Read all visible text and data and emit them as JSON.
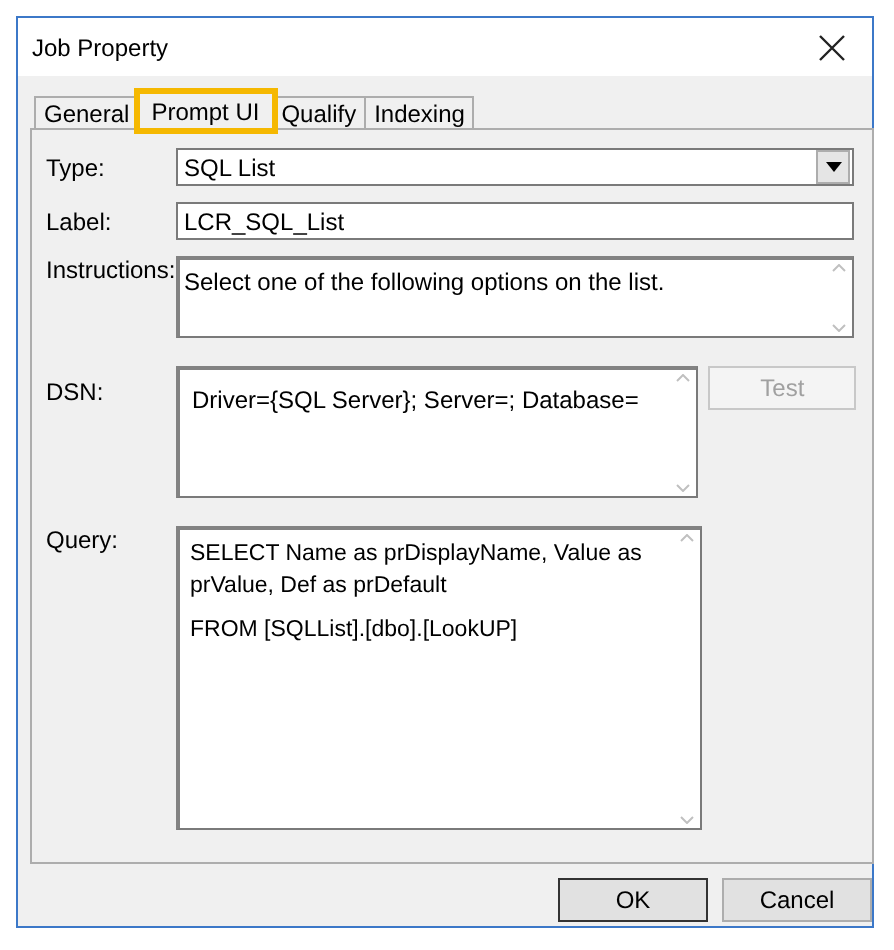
{
  "window": {
    "title": "Job Property"
  },
  "tabs": [
    {
      "label": "General",
      "selected": false,
      "highlighted": false
    },
    {
      "label": "Prompt UI",
      "selected": true,
      "highlighted": true
    },
    {
      "label": "Qualify",
      "selected": false,
      "highlighted": false
    },
    {
      "label": "Indexing",
      "selected": false,
      "highlighted": false
    }
  ],
  "fields": [
    {
      "kind": "dropdown",
      "label": "Type:",
      "value": "SQL List"
    },
    {
      "kind": "text",
      "label": "Label:",
      "value": "LCR_SQL_List"
    },
    {
      "kind": "memo",
      "label": "Instructions:",
      "value": "Select one of the following options on the list."
    },
    {
      "kind": "dsn",
      "label": "DSN:",
      "value": "Driver={SQL Server}; Server=; Database=",
      "button": {
        "label": "Test",
        "disabled": true
      }
    },
    {
      "kind": "query",
      "label": "Query:",
      "lines": [
        "SELECT Name as prDisplayName, Value as prValue, Def as prDefault",
        "FROM [SQLList].[dbo].[LookUP]"
      ]
    }
  ],
  "buttons": [
    {
      "label": "OK",
      "default": true
    },
    {
      "label": "Cancel",
      "default": false
    }
  ]
}
